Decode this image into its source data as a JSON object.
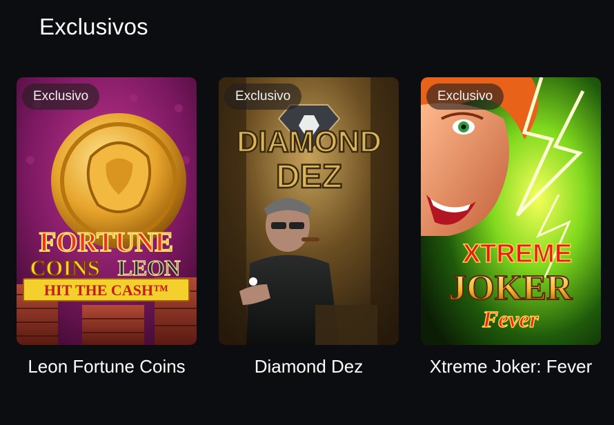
{
  "section": {
    "title": "Exclusivos"
  },
  "colors": {
    "background": "#0c0d10",
    "badge_bg": "#231e1e",
    "text": "#ffffff"
  },
  "games": [
    {
      "badge": "Exclusivo",
      "title": "Leon Fortune Coins",
      "art": {
        "logo_line1": "FORTUNE",
        "logo_line2": "COINS",
        "logo_line2b": "LEON",
        "tagline": "HIT THE CASH™"
      }
    },
    {
      "badge": "Exclusivo",
      "title": "Diamond Dez",
      "art": {
        "logo_line1": "DIAMOND",
        "logo_line2": "DEZ"
      }
    },
    {
      "badge": "Exclusivo",
      "title": "Xtreme Joker: Fever",
      "art": {
        "logo_line1": "XTREME",
        "logo_line2": "JOKER",
        "logo_line3": "Fever"
      }
    }
  ]
}
